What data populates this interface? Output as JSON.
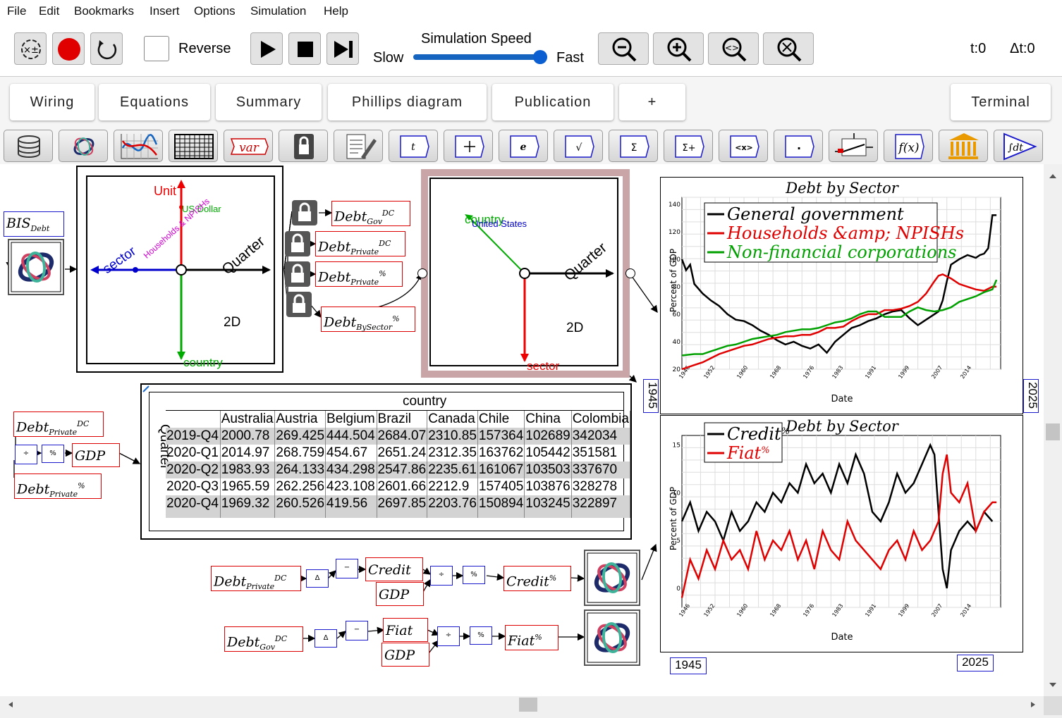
{
  "menu": [
    "File",
    "Edit",
    "Bookmarks",
    "Insert",
    "Options",
    "Simulation",
    "Help"
  ],
  "toolbar": {
    "reverse_label": "Reverse",
    "speed_title": "Simulation Speed",
    "slow_label": "Slow",
    "fast_label": "Fast",
    "t_label": "t:0",
    "dt_label": "Δt:0",
    "speed_level": 1.0
  },
  "tabs": [
    "Wiring",
    "Equations",
    "Summary",
    "Phillips diagram",
    "Publication",
    "+"
  ],
  "terminal_tab": "Terminal",
  "palette": {
    "var_label": "var",
    "time_label": "t",
    "e_label": "e",
    "sqrt_label": "√",
    "sum_label": "Σ",
    "sumplus_label": "Σ+",
    "x_label": "<x>",
    "dot_label": ".",
    "fx_label": "f(x)",
    "integral_label": "∫dt"
  },
  "canvas": {
    "bis": {
      "name": "BIS",
      "sub": "Debt"
    },
    "ravel1": {
      "unit_label": "Unit",
      "unit_value": "US Dollar",
      "sector_label": "sector",
      "sector_value": "Households & NPISHs",
      "quarter_label": "Quarter",
      "country_label": "country",
      "dim_label": "2D"
    },
    "ravel2": {
      "country_label": "country",
      "country_value": "United States",
      "quarter_label": "Quarter",
      "sector_label": "sector",
      "dim_label": "2D"
    },
    "vars": {
      "debt_gov": {
        "name": "Debt",
        "sub": "Gov",
        "sup": "DC"
      },
      "debt_private": {
        "name": "Debt",
        "sub": "Private",
        "sup": "DC"
      },
      "debt_private_pct": {
        "name": "Debt",
        "sub": "Private",
        "sup": "%"
      },
      "debt_bysector_pct": {
        "name": "Debt",
        "sub": "BySector",
        "sup": "%"
      },
      "gdp": {
        "name": "GDP"
      },
      "credit": {
        "name": "Credit"
      },
      "credit_pct": {
        "name": "Credit",
        "sup": "%"
      },
      "fiat": {
        "name": "Fiat"
      },
      "fiat_pct": {
        "name": "Fiat",
        "sup": "%"
      }
    },
    "ops": {
      "divide": "÷",
      "percent": "%",
      "delta": "Δ",
      "minus": "−"
    },
    "table": {
      "col_dim": "country",
      "row_dim": "Quarter",
      "columns": [
        "Australia",
        "Austria",
        "Belgium",
        "Brazil",
        "Canada",
        "Chile",
        "China",
        "Colombia"
      ],
      "rows": [
        {
          "label": "2019-Q4",
          "values": [
            "2000.78",
            "269.425",
            "444.504",
            "2684.07",
            "2310.85",
            "157364",
            "102689",
            "342034"
          ]
        },
        {
          "label": "2020-Q1",
          "values": [
            "2014.97",
            "268.759",
            "454.67",
            "2651.24",
            "2312.35",
            "163762",
            "105442",
            "351581"
          ]
        },
        {
          "label": "2020-Q2",
          "values": [
            "1983.93",
            "264.133",
            "434.298",
            "2547.86",
            "2235.61",
            "161067",
            "103503",
            "337670"
          ]
        },
        {
          "label": "2020-Q3",
          "values": [
            "1965.59",
            "262.256",
            "423.108",
            "2601.66",
            "2212.9",
            "157405",
            "103876",
            "328278"
          ]
        },
        {
          "label": "2020-Q4",
          "values": [
            "1969.32",
            "260.526",
            "419.56",
            "2697.85",
            "2203.76",
            "150894",
            "103245",
            "322897"
          ]
        }
      ]
    }
  },
  "chart_data": [
    {
      "type": "line",
      "title": "Debt by Sector",
      "xlabel": "Date",
      "ylabel": "Percent of GDP",
      "x_ticks": [
        "1946",
        "1952",
        "1960",
        "1968",
        "1976",
        "1983",
        "1991",
        "1999",
        "2007",
        "2014"
      ],
      "y_ticks": [
        "20",
        "40",
        "60",
        "80",
        "100",
        "120",
        "140"
      ],
      "ylim": [
        20,
        145
      ],
      "xlim": [
        1945,
        2022
      ],
      "xmin_label": "1945",
      "xmax_label": "2025",
      "grid": true,
      "legend_position": "top",
      "series": [
        {
          "name": "General government",
          "color": "#000000",
          "x": [
            1945,
            1946,
            1947,
            1948,
            1950,
            1952,
            1954,
            1956,
            1958,
            1960,
            1962,
            1964,
            1966,
            1968,
            1970,
            1972,
            1974,
            1976,
            1978,
            1980,
            1982,
            1984,
            1986,
            1988,
            1990,
            1992,
            1994,
            1996,
            1998,
            2000,
            2002,
            2004,
            2006,
            2007,
            2008,
            2009,
            2010,
            2012,
            2014,
            2016,
            2017,
            2018,
            2019,
            2020,
            2021
          ],
          "y": [
            100,
            92,
            96,
            82,
            75,
            70,
            66,
            60,
            56,
            55,
            52,
            48,
            45,
            41,
            38,
            40,
            37,
            35,
            38,
            32,
            40,
            45,
            50,
            52,
            55,
            57,
            60,
            62,
            63,
            57,
            52,
            56,
            60,
            62,
            70,
            84,
            96,
            100,
            103,
            101,
            103,
            104,
            108,
            132,
            132
          ]
        },
        {
          "name": "Households &amp; NPISHs",
          "color": "#e00000",
          "x": [
            1945,
            1948,
            1950,
            1952,
            1954,
            1956,
            1958,
            1960,
            1962,
            1964,
            1966,
            1968,
            1970,
            1972,
            1974,
            1976,
            1978,
            1980,
            1982,
            1984,
            1986,
            1988,
            1990,
            1992,
            1994,
            1996,
            1998,
            2000,
            2002,
            2004,
            2006,
            2007,
            2008,
            2010,
            2012,
            2014,
            2016,
            2018,
            2020,
            2021
          ],
          "y": [
            20,
            23,
            25,
            28,
            31,
            33,
            35,
            37,
            38,
            40,
            42,
            43,
            44,
            44,
            45,
            45,
            47,
            50,
            50,
            51,
            55,
            58,
            60,
            60,
            63,
            63,
            64,
            66,
            69,
            75,
            84,
            88,
            89,
            86,
            82,
            80,
            78,
            77,
            80,
            80
          ]
        },
        {
          "name": "Non-financial corporations",
          "color": "#00a000",
          "x": [
            1945,
            1948,
            1950,
            1952,
            1954,
            1956,
            1958,
            1960,
            1962,
            1964,
            1966,
            1968,
            1970,
            1972,
            1974,
            1976,
            1978,
            1980,
            1982,
            1984,
            1986,
            1988,
            1990,
            1992,
            1994,
            1996,
            1998,
            2000,
            2002,
            2004,
            2006,
            2008,
            2010,
            2012,
            2014,
            2016,
            2018,
            2020,
            2021
          ],
          "y": [
            30,
            31,
            31,
            33,
            35,
            37,
            38,
            40,
            42,
            43,
            44,
            45,
            47,
            48,
            49,
            49,
            50,
            52,
            54,
            55,
            57,
            60,
            62,
            62,
            58,
            58,
            58,
            62,
            65,
            63,
            62,
            63,
            65,
            69,
            71,
            73,
            76,
            78,
            85
          ]
        }
      ]
    },
    {
      "type": "line",
      "title": "Debt by Sector",
      "xlabel": "Date",
      "ylabel": "Percent of GDP",
      "x_ticks": [
        "1946",
        "1952",
        "1960",
        "1968",
        "1976",
        "1983",
        "1991",
        "1999",
        "2007",
        "2014"
      ],
      "y_ticks": [
        "0",
        "5",
        "10",
        "15"
      ],
      "ylim": [
        -2,
        16
      ],
      "xlim": [
        1945,
        2022
      ],
      "xmin_label": "1945",
      "xmax_label": "2025",
      "grid": true,
      "legend_position": "top-left",
      "series": [
        {
          "name": "Credit",
          "sup": "%",
          "color": "#000000",
          "x": [
            1945,
            1947,
            1949,
            1951,
            1953,
            1955,
            1957,
            1959,
            1961,
            1963,
            1965,
            1967,
            1969,
            1971,
            1973,
            1975,
            1977,
            1979,
            1981,
            1983,
            1985,
            1987,
            1989,
            1991,
            1993,
            1995,
            1997,
            1999,
            2001,
            2003,
            2005,
            2006,
            2007,
            2008,
            2009,
            2010,
            2012,
            2014,
            2016,
            2018,
            2020
          ],
          "y": [
            7,
            9,
            6,
            8,
            7,
            5,
            8,
            6,
            7,
            9,
            8,
            10,
            9,
            11,
            10,
            13,
            11,
            12,
            10,
            13,
            11,
            14,
            12,
            8,
            7,
            9,
            12,
            10,
            11,
            13,
            15,
            14,
            8,
            2,
            0,
            4,
            6,
            7,
            6,
            8,
            7
          ]
        },
        {
          "name": "Fiat",
          "sup": "%",
          "color": "#e00000",
          "x": [
            1945,
            1947,
            1949,
            1951,
            1953,
            1955,
            1957,
            1959,
            1961,
            1963,
            1965,
            1967,
            1969,
            1971,
            1973,
            1975,
            1977,
            1979,
            1981,
            1983,
            1985,
            1987,
            1989,
            1991,
            1993,
            1995,
            1997,
            1999,
            2001,
            2003,
            2005,
            2007,
            2008,
            2009,
            2010,
            2012,
            2014,
            2016,
            2018,
            2020,
            2021
          ],
          "y": [
            -1,
            3,
            1,
            4,
            2,
            5,
            3,
            4,
            2,
            6,
            3,
            5,
            4,
            6,
            3,
            5,
            2,
            6,
            4,
            3,
            7,
            5,
            4,
            3,
            2,
            4,
            5,
            3,
            6,
            4,
            5,
            7,
            12,
            14,
            10,
            9,
            11,
            6,
            8,
            9,
            9
          ]
        }
      ]
    }
  ]
}
